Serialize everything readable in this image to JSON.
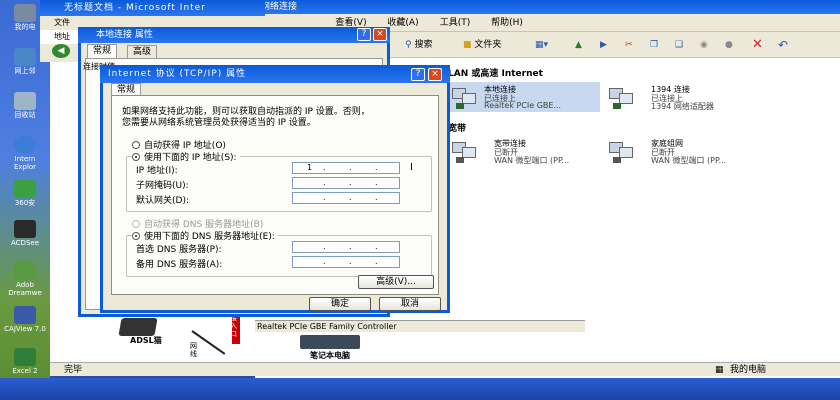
{
  "desktop": {
    "icons": [
      {
        "label": "我的电",
        "color": "#7a8aa0"
      },
      {
        "label": "网上邻",
        "color": "#4a86c8"
      },
      {
        "label": "回收站",
        "color": "#a0b4c8"
      },
      {
        "label": "Intern Explor",
        "color": "#3a7ed8"
      },
      {
        "label": "360安",
        "color": "#3aa040"
      },
      {
        "label": "ACDSee",
        "color": "#2a2a2a"
      },
      {
        "label": "Adob Dreamwe",
        "color": "#5a9a40"
      },
      {
        "label": "CAJView 7.0",
        "color": "#3a5aa8"
      },
      {
        "label": "Excel 2",
        "color": "#2f7f3a"
      }
    ]
  },
  "ie_window": {
    "title": "无标题文档 - Microsoft Inter",
    "menu": [
      "文件",
      "地址"
    ]
  },
  "network_window": {
    "title": "网络连接",
    "menu": [
      "查看(V)",
      "收藏(A)",
      "工具(T)",
      "帮助(H)"
    ],
    "toolbar": {
      "search": "搜索",
      "folders": "文件夹"
    },
    "section_lan": "LAN 或高速 Internet",
    "section_broadband": "宽带",
    "connections": [
      {
        "name": "本地连接",
        "status": "已连接上",
        "device": "Realtek PCIe GBE..."
      },
      {
        "name": "1394 连接",
        "status": "已连接上",
        "device": "1394 网络适配器"
      },
      {
        "name": "宽带连接",
        "status": "已断开",
        "device": "WAN 微型端口 (PP..."
      },
      {
        "name": "家庭组网",
        "status": "已断开",
        "device": "WAN 微型端口 (PP..."
      }
    ],
    "status_text": "完毕",
    "status_right": "我的电脑",
    "adapter_text": "Realtek PCIe GBE Family Controller"
  },
  "diagram": {
    "router_label": "ADSL猫",
    "laptop_label": "笔记本电脑",
    "cable_red": "接入口",
    "cable_black": "网线"
  },
  "lan_props": {
    "title": "本地连接 属性",
    "tabs": [
      "常规",
      "高级"
    ],
    "side_labels": [
      "连接时使"
    ]
  },
  "tcpip": {
    "title": "Internet 协议 (TCP/IP) 属性",
    "tab": "常规",
    "intro_line1": "如果网络支持此功能，则可以获取自动指派的 IP 设置。否则，",
    "intro_line2": "您需要从网络系统管理员处获得适当的 IP 设置。",
    "auto_ip": "自动获得 IP 地址(O)",
    "manual_ip": "使用下面的 IP 地址(S):",
    "ip_label": "IP 地址(I):",
    "mask_label": "子网掩码(U):",
    "gateway_label": "默认网关(D):",
    "ip_value": "1",
    "auto_dns": "自动获得 DNS 服务器地址(B)",
    "manual_dns": "使用下面的 DNS 服务器地址(E):",
    "pref_dns_label": "首选 DNS 服务器(P):",
    "alt_dns_label": "备用 DNS 服务器(A):",
    "advanced_button": "高级(V)...",
    "ok_button": "确定",
    "cancel_button": "取消",
    "help_glyph": "?",
    "close_glyph": "×",
    "dot": "."
  }
}
